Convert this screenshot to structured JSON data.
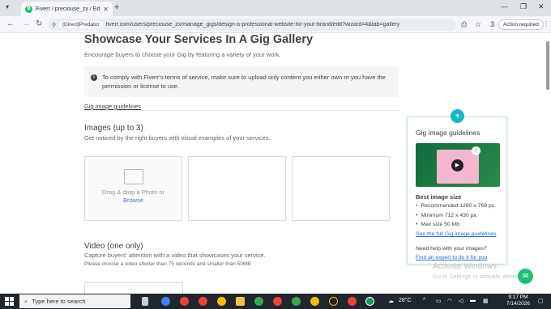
{
  "browser": {
    "tab_title": "Fiverr / preciouse_zx / Edit Gig",
    "tab_favicon": "B",
    "url": "fiverr.com/users/preciouse_zx/manage_gigs/design-a-professional-website-for-your-brand/edit?wizard=4&tab=gallery",
    "site_tag": "[Direct]Predator",
    "badge_count": "3",
    "action_required": "Action required"
  },
  "page": {
    "title": "Showcase Your Services In A Gig Gallery",
    "subtitle": "Encourage buyers to choose your Gig by featuring a variety of your work.",
    "notice": "To comply with Fiverr's terms of service, make sure to upload only content you either own or you have the permission or license to use.",
    "guidelines_link": "Gig image guidelines",
    "images": {
      "title": "Images (up to 3)",
      "subtitle": "Get noticed by the right buyers with visual examples of your services.",
      "drag_text": "Drag & drop a Photo or",
      "browse": "Browse"
    },
    "video": {
      "title": "Video (one only)",
      "subtitle": "Capture buyers' attention with a video that showcases your service.",
      "note": "Please choose a video shorter than 75 seconds and smaller than 50MB"
    }
  },
  "tooltip": {
    "title": "Gig image guidelines",
    "best_size_title": "Best image size",
    "items": [
      "Recommended 1280 x 769 px.",
      "Minimum 712 x 430 px.",
      "Max size 50 Mb"
    ],
    "full_link": "See the full Gig image guidelines",
    "help": "Need help with your images?",
    "hire_link": "Find an expert to do it for you",
    "accent_color": "#1dbf73"
  },
  "watermark": {
    "line1": "Activate Windows",
    "line2": "Go to Settings to activate Windows."
  },
  "taskbar": {
    "search_placeholder": "Type here to search",
    "weather": "28°C",
    "time": "9:17 PM",
    "date": "7/14/2026"
  }
}
